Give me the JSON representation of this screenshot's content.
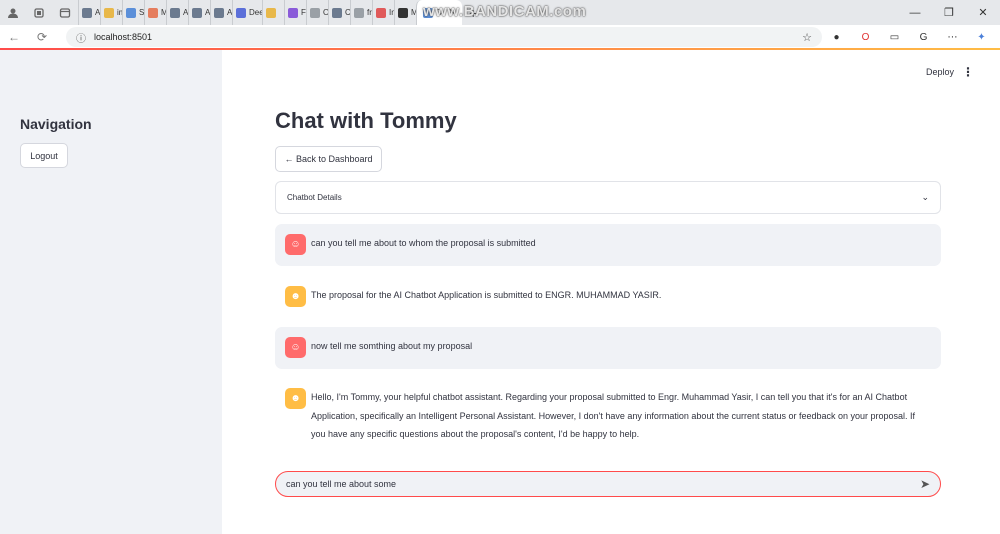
{
  "browser": {
    "tabs": [
      {
        "label": "AI Pro",
        "color": "#6b7a8f"
      },
      {
        "label": "impro",
        "color": "#e8b84a"
      },
      {
        "label": "Static",
        "color": "#5b8fd9"
      },
      {
        "label": "Mater",
        "color": "#e57d5e"
      },
      {
        "label": "AI Ch",
        "color": "#6b7a8f"
      },
      {
        "label": "AI Ch",
        "color": "#6b7a8f"
      },
      {
        "label": "Add I",
        "color": "#6b7a8f"
      },
      {
        "label": "Dee",
        "color": "#5b6fd9"
      },
      {
        "label": "",
        "color": "#e8b84a"
      },
      {
        "label": "Figlar",
        "color": "#8a5bd9"
      },
      {
        "label": "One-",
        "color": "#9aa0a6"
      },
      {
        "label": "Codu",
        "color": "#6b7a8f"
      },
      {
        "label": "free s",
        "color": "#9aa0a6"
      },
      {
        "label": "Introd",
        "color": "#e05a5a"
      },
      {
        "label": "MULT",
        "color": "#333333"
      }
    ],
    "active_tab": {
      "label": "C",
      "color": "#5b8fd9"
    },
    "url": "localhost:8501",
    "watermark": "www.BANDICAM.com"
  },
  "sidebar": {
    "title": "Navigation",
    "logout_label": "Logout"
  },
  "header": {
    "deploy_label": "Deploy"
  },
  "main": {
    "title": "Chat with Tommy",
    "back_label": "← Back to Dashboard",
    "expander_label": "Chatbot Details"
  },
  "messages": [
    {
      "role": "user",
      "text": "can you tell me about to whom the proposal is submitted"
    },
    {
      "role": "assistant",
      "text": "The proposal for the AI Chatbot Application is submitted to ENGR. MUHAMMAD YASIR."
    },
    {
      "role": "user",
      "text": "now tell me somthing about my proposal"
    },
    {
      "role": "assistant",
      "text": "Hello, I'm Tommy, your helpful chatbot assistant. Regarding your proposal submitted to Engr. Muhammad Yasir, I can tell you that it's for an AI Chatbot Application, specifically an Intelligent Personal Assistant. However, I don't have any information about the current status or feedback on your proposal. If you have any specific questions about the proposal's content, I'd be happy to help."
    }
  ],
  "chat_input": {
    "value": "can you tell me about some"
  },
  "colors": {
    "accent": "#ff4b4b",
    "user_avatar": "#ff6b6b",
    "bot_avatar": "#ffbd45",
    "sidebar_bg": "#f0f2f6"
  }
}
